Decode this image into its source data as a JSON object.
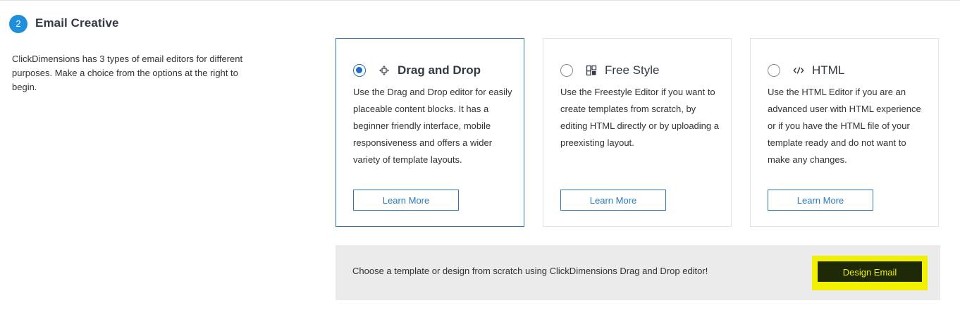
{
  "section": {
    "step_number": "2",
    "title": "Email Creative",
    "intro": "ClickDimensions has 3 types of email editors for different purposes. Make a choice from the options at the right to begin."
  },
  "editors": [
    {
      "label": "Drag and Drop",
      "icon": "drag-drop-icon",
      "selected": true,
      "description": "Use the Drag and Drop editor for easily placeable content blocks. It has a beginner friendly interface, mobile responsiveness and offers a wider variety of template layouts.",
      "button_label": "Learn More"
    },
    {
      "label": "Free Style",
      "icon": "layout-blocks-icon",
      "selected": false,
      "description": "Use the Freestyle Editor if you want to create templates from scratch, by editing HTML directly or by uploading a preexisting layout.",
      "button_label": "Learn More"
    },
    {
      "label": "HTML",
      "icon": "code-icon",
      "selected": false,
      "description": "Use the HTML Editor if you are an advanced user with HTML experience or if you have the HTML file of your template ready and do not want to make any changes.",
      "button_label": "Learn More"
    }
  ],
  "footer": {
    "message": "Choose a template or design from scratch using ClickDimensions Drag and Drop editor!",
    "design_button_label": "Design Email"
  },
  "colors": {
    "accent_blue": "#2a7ab8",
    "radio_blue": "#1e6ccc",
    "step_badge": "#1f8fdc",
    "highlight_yellow": "#f0f000",
    "design_button_bg": "#1c2806"
  }
}
